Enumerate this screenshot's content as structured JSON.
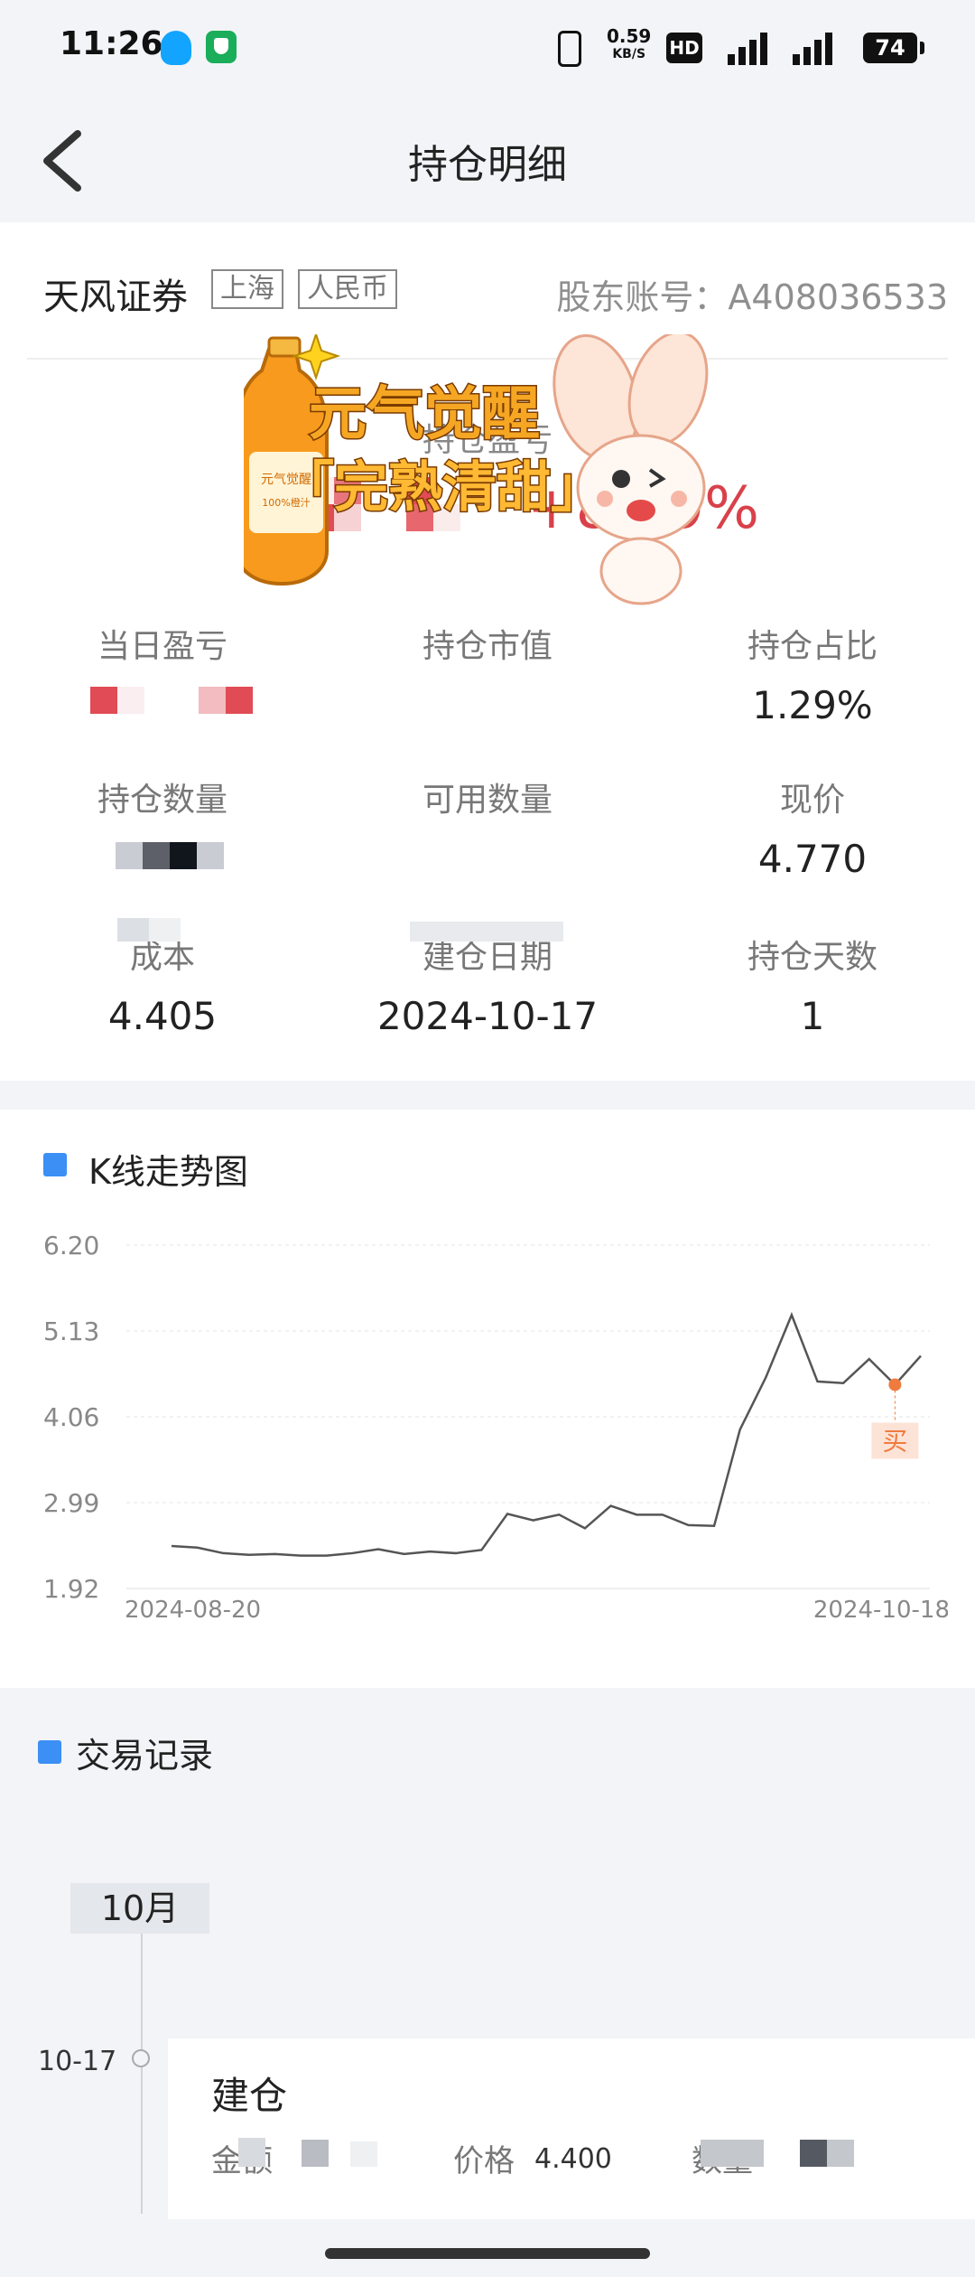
{
  "status_bar": {
    "time": "11:26",
    "net_speed_value": "0.59",
    "net_speed_unit": "KB/S",
    "hd_label": "HD",
    "network_1": "5G",
    "network_2": "5G",
    "battery": "74"
  },
  "nav": {
    "title": "持仓明细"
  },
  "position": {
    "broker": "天风证券",
    "market_tag": "上海",
    "currency_tag": "人民币",
    "account": "股东账号：A408036533",
    "pl_label": "持仓盈亏",
    "pl_pct": "+8.29%",
    "metrics": [
      {
        "label": "当日盈亏",
        "value": ""
      },
      {
        "label": "持仓市值",
        "value": ""
      },
      {
        "label": "持仓占比",
        "value": "1.29%"
      },
      {
        "label": "持仓数量",
        "value": ""
      },
      {
        "label": "可用数量",
        "value": ""
      },
      {
        "label": "现价",
        "value": "4.770"
      },
      {
        "label": "成本",
        "value": "4.405"
      },
      {
        "label": "建仓日期",
        "value": "2024-10-17"
      },
      {
        "label": "持仓天数",
        "value": "1"
      }
    ]
  },
  "sticker": {
    "line1": "元气觉醒",
    "line2": "「完熟清甜」",
    "bottle_label": "元气觉醒",
    "bottle_sub": "100%橙汁"
  },
  "kline_section": {
    "title": "K线走势图"
  },
  "chart_data": {
    "type": "line",
    "title": "K线走势图",
    "xlabel": "",
    "ylabel": "",
    "y_ticks": [
      "6.20",
      "5.13",
      "4.06",
      "2.99",
      "1.92"
    ],
    "ylim": [
      1.92,
      6.2
    ],
    "x_tick_labels": [
      "2024-08-20",
      "2024-10-18"
    ],
    "grid": true,
    "values": [
      2.45,
      2.43,
      2.36,
      2.34,
      2.35,
      2.33,
      2.33,
      2.36,
      2.41,
      2.35,
      2.38,
      2.36,
      2.4,
      2.85,
      2.77,
      2.84,
      2.67,
      2.95,
      2.84,
      2.84,
      2.71,
      2.7,
      3.9,
      4.55,
      5.33,
      4.5,
      4.48,
      4.78,
      4.46,
      4.82
    ],
    "buy_marker": {
      "index": 28,
      "label": "买"
    },
    "line_color": "#555555",
    "marker_color": "#f07b3f"
  },
  "trades": {
    "title": "交易记录",
    "month": "10月",
    "items": [
      {
        "date": "10-17",
        "type": "建仓",
        "amount_label": "金额",
        "price_label": "价格",
        "price": "4.400",
        "qty_label": "数量"
      }
    ]
  }
}
